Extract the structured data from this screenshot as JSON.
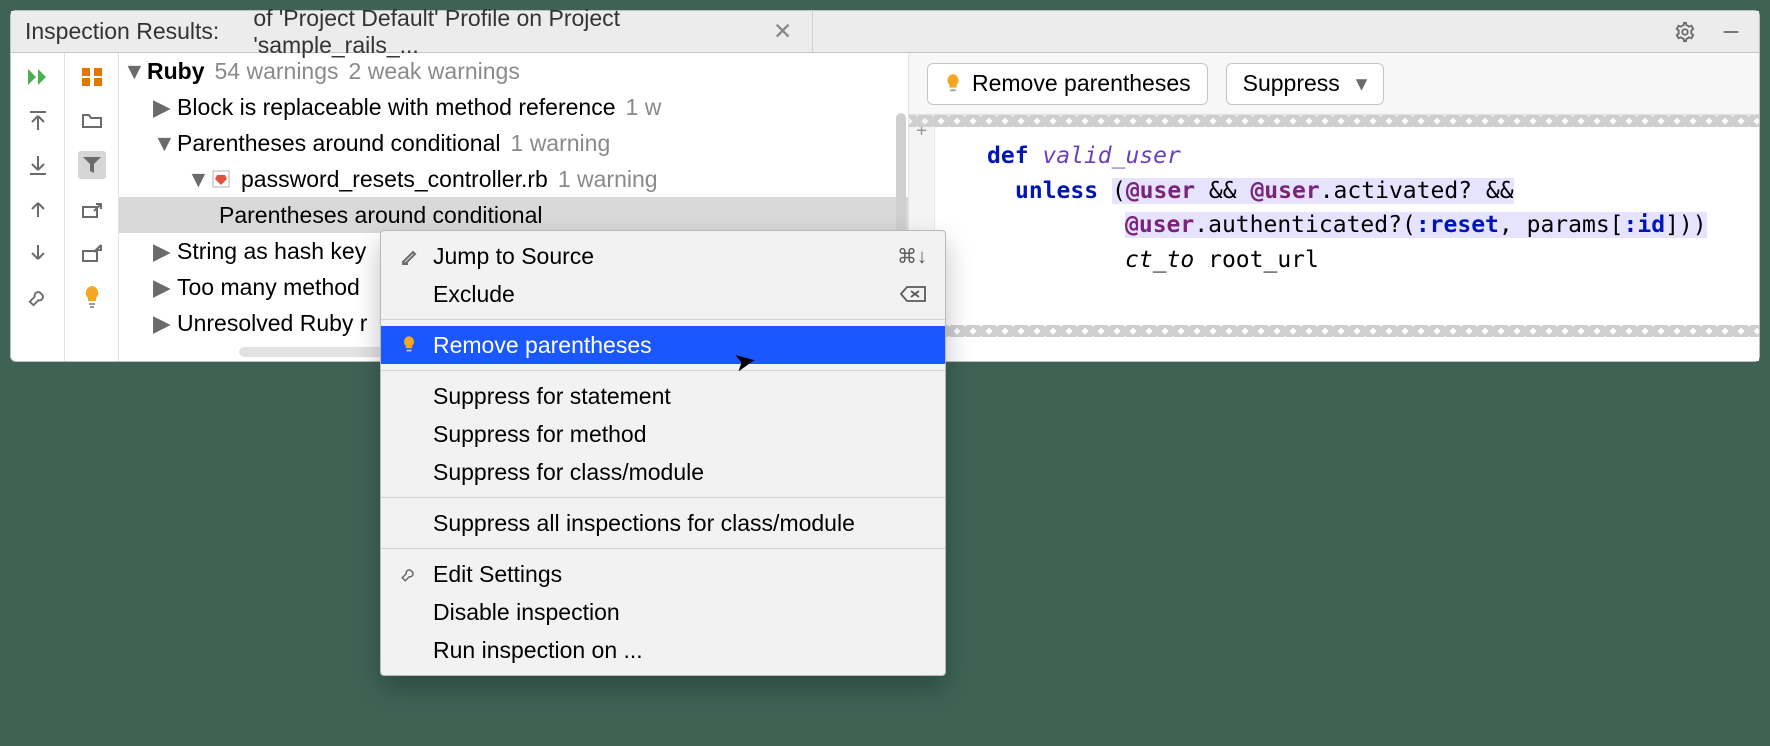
{
  "header": {
    "title": "Inspection Results:",
    "tab": "of 'Project Default' Profile on Project 'sample_rails_..."
  },
  "tree": {
    "root": {
      "name": "Ruby",
      "suffix1": "54 warnings",
      "suffix2": "2 weak warnings"
    },
    "n1": {
      "label": "Block is replaceable with method reference",
      "suffix": "1 w"
    },
    "n2": {
      "label": "Parentheses around conditional",
      "suffix": "1 warning"
    },
    "n2f": {
      "label": "password_resets_controller.rb",
      "suffix": "1 warning"
    },
    "n2s": {
      "label": "Parentheses around conditional"
    },
    "n3": {
      "label": "String as hash key"
    },
    "n4": {
      "label": "Too many method"
    },
    "n5": {
      "label": "Unresolved Ruby r"
    }
  },
  "actions": {
    "quickfix": "Remove parentheses",
    "suppress": "Suppress"
  },
  "code": {
    "l1_def": "def",
    "l1_fn": "valid_user",
    "l2_a": "unless",
    "l2_b": "(",
    "l2_c": "@user",
    "l2_d": " && ",
    "l2_e": "@user",
    "l2_f": ".activated? &&",
    "l3_a": "@user",
    "l3_b": ".authenticated?(",
    "l3_c": ":reset",
    "l3_d": ", params[",
    "l3_e": ":id",
    "l3_f": "]))",
    "l4_a": "ct_to",
    "l4_b": " root_url"
  },
  "menu": {
    "m1": "Jump to Source",
    "m1s": "⌘↓",
    "m2": "Exclude",
    "m2s": "⌫",
    "m3": "Remove parentheses",
    "m4": "Suppress for statement",
    "m5": "Suppress for method",
    "m6": "Suppress for class/module",
    "m7": "Suppress all inspections for class/module",
    "m8": "Edit Settings",
    "m9": "Disable inspection",
    "m10": "Run inspection on ..."
  },
  "glyphs": {
    "plus": "+"
  }
}
